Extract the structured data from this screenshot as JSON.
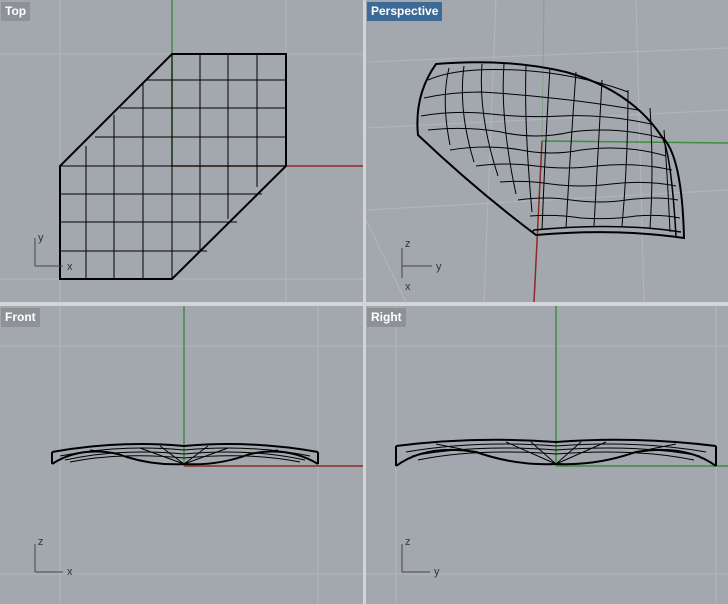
{
  "viewports": {
    "top": {
      "label": "Top",
      "axis_a": "y",
      "axis_b": "x"
    },
    "perspective": {
      "label": "Perspective",
      "axis_a": "z",
      "axis_b": "y",
      "axis_c": "x"
    },
    "front": {
      "label": "Front",
      "axis_a": "z",
      "axis_b": "x"
    },
    "right": {
      "label": "Right",
      "axis_a": "z",
      "axis_b": "y"
    }
  },
  "active_viewport": "perspective",
  "colors": {
    "viewport_bg": "#a3a8ae",
    "grid": "#b3b7bc",
    "x_axis": "#8b2a22",
    "y_axis": "#3e8e3e",
    "wire": "#000000",
    "label_bg": "#8e9297",
    "active_label_bg": "#3e6a96"
  }
}
